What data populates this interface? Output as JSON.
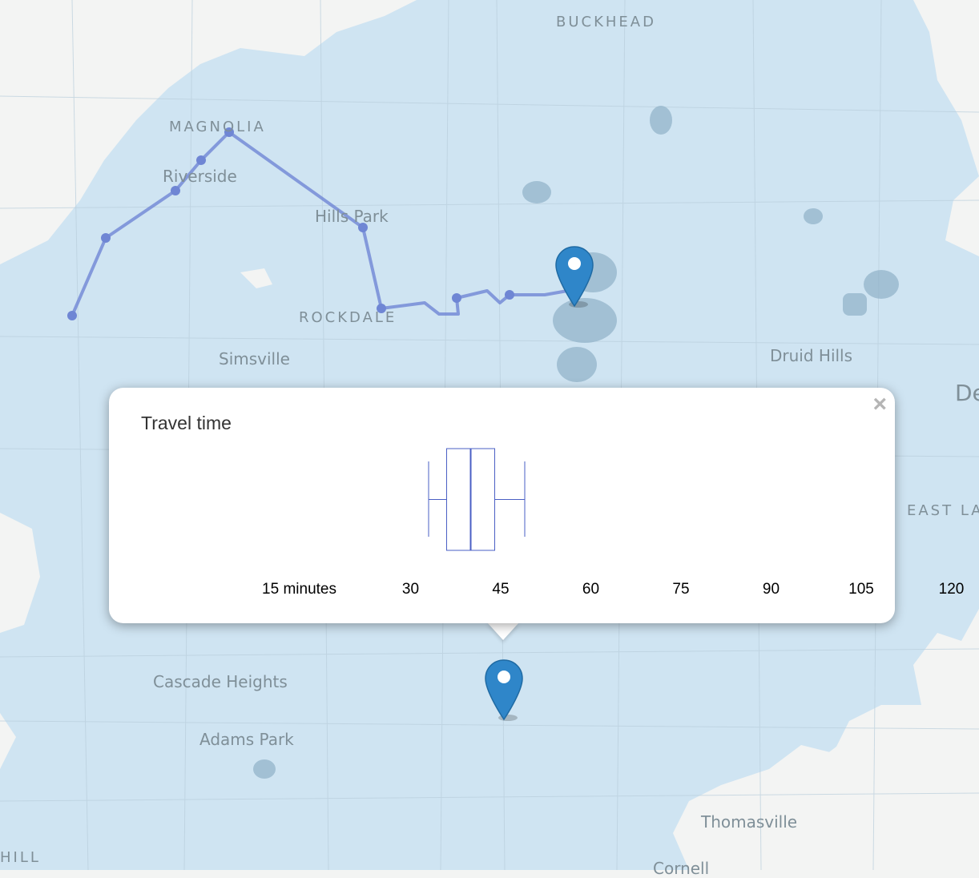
{
  "map": {
    "labels": [
      {
        "id": "buckhead",
        "text": "BUCKHEAD"
      },
      {
        "id": "magnolia",
        "text": "MAGNOLIA"
      },
      {
        "id": "riverside",
        "text": "Riverside"
      },
      {
        "id": "hills-park",
        "text": "Hills Park"
      },
      {
        "id": "rockdale",
        "text": "ROCKDALE"
      },
      {
        "id": "simsville",
        "text": "Simsville"
      },
      {
        "id": "druid-hills",
        "text": "Druid Hills"
      },
      {
        "id": "de",
        "text": "De"
      },
      {
        "id": "east-la",
        "text": "EAST LA"
      },
      {
        "id": "cascade-heights",
        "text": "Cascade Heights"
      },
      {
        "id": "adams-park",
        "text": "Adams Park"
      },
      {
        "id": "thomasville",
        "text": "Thomasville"
      },
      {
        "id": "hill",
        "text": "HILL"
      },
      {
        "id": "cornell",
        "text": "Cornell"
      }
    ],
    "colors": {
      "isochrone": "#cfe4f2",
      "route": "#6f86d4",
      "pin": "#2f86c9"
    },
    "pins": [
      {
        "id": "origin",
        "icon": "map-marker-icon"
      },
      {
        "id": "destination",
        "icon": "map-marker-icon"
      }
    ]
  },
  "popup": {
    "title": "Travel time",
    "close_icon": "close-icon",
    "close_glyph": "×",
    "chart_data": {
      "type": "boxplot",
      "title": "Travel time",
      "xlabel": "",
      "x_ticks": [
        "15 minutes",
        "30",
        "45",
        "60",
        "75",
        "90",
        "105",
        "120"
      ],
      "x_tick_values": [
        15,
        30,
        45,
        60,
        75,
        90,
        105,
        120
      ],
      "box": {
        "whisker_low": 33,
        "q1": 36,
        "median": 40,
        "q3": 44,
        "whisker_high": 49
      },
      "color": "#4a5fc4"
    }
  }
}
